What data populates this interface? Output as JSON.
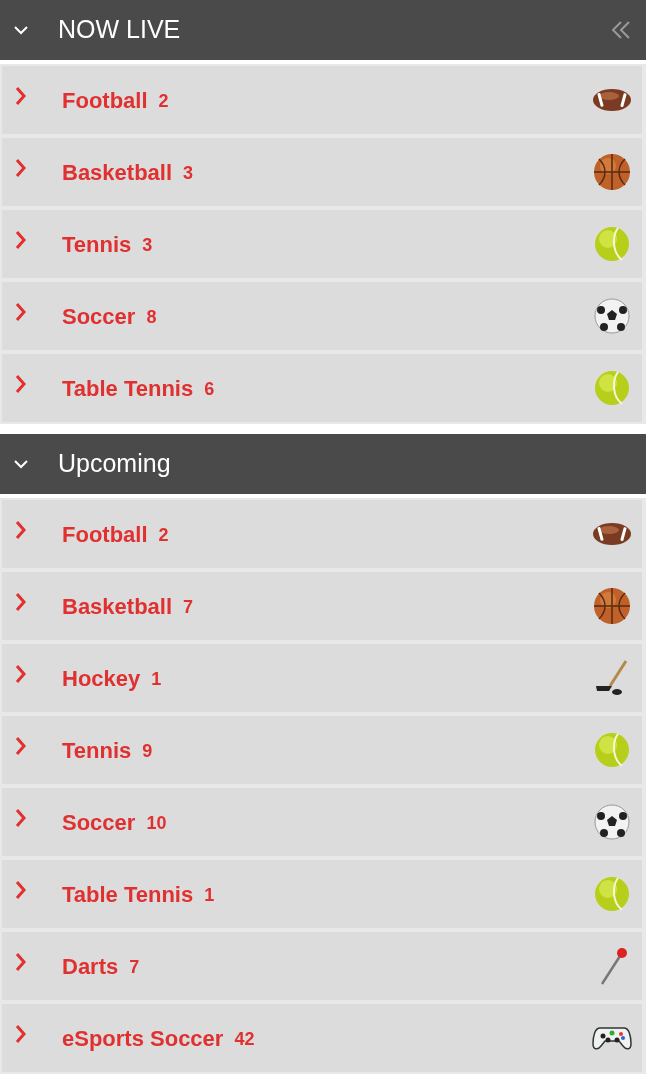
{
  "sections": [
    {
      "title": "NOW LIVE",
      "expanded": true,
      "collapse_panel": true,
      "items": [
        {
          "name": "Football",
          "count": "2",
          "kind": "football"
        },
        {
          "name": "Basketball",
          "count": "3",
          "kind": "basketball"
        },
        {
          "name": "Tennis",
          "count": "3",
          "kind": "tennis"
        },
        {
          "name": "Soccer",
          "count": "8",
          "kind": "soccer"
        },
        {
          "name": "Table Tennis",
          "count": "6",
          "kind": "tennis"
        }
      ]
    },
    {
      "title": "Upcoming",
      "expanded": true,
      "collapse_panel": false,
      "items": [
        {
          "name": "Football",
          "count": "2",
          "kind": "football"
        },
        {
          "name": "Basketball",
          "count": "7",
          "kind": "basketball"
        },
        {
          "name": "Hockey",
          "count": "1",
          "kind": "hockey"
        },
        {
          "name": "Tennis",
          "count": "9",
          "kind": "tennis"
        },
        {
          "name": "Soccer",
          "count": "10",
          "kind": "soccer"
        },
        {
          "name": "Table Tennis",
          "count": "1",
          "kind": "tennis"
        },
        {
          "name": "Darts",
          "count": "7",
          "kind": "darts"
        },
        {
          "name": "eSports Soccer",
          "count": "42",
          "kind": "gamepad"
        }
      ]
    }
  ]
}
